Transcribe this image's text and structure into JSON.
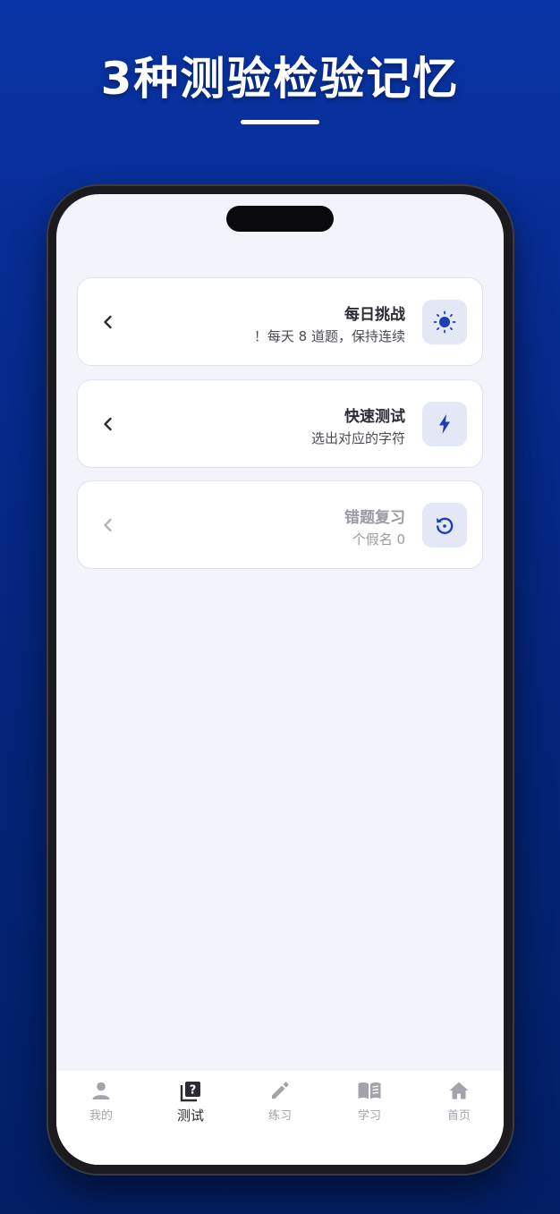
{
  "headline": "3种测验检验记忆",
  "cards": [
    {
      "title": "每日挑战",
      "subtitle": "！每天 8 道题，保持连续",
      "icon": "sun-icon"
    },
    {
      "title": "快速测试",
      "subtitle": "选出对应的字符",
      "icon": "lightning-icon"
    },
    {
      "title": "错题复习",
      "subtitle": "个假名 0",
      "icon": "refresh-icon"
    }
  ],
  "tabs": [
    {
      "label": "我的",
      "icon": "person-icon"
    },
    {
      "label": "测试",
      "icon": "quiz-icon"
    },
    {
      "label": "练习",
      "icon": "pencil-icon"
    },
    {
      "label": "学习",
      "icon": "book-icon"
    },
    {
      "label": "首页",
      "icon": "home-icon"
    }
  ],
  "colors": {
    "accent": "#1e3fb0",
    "card_icon_bg": "#e3e7f6",
    "tab_active": "#2b2c33",
    "tab_inactive": "#a3a4ab"
  }
}
